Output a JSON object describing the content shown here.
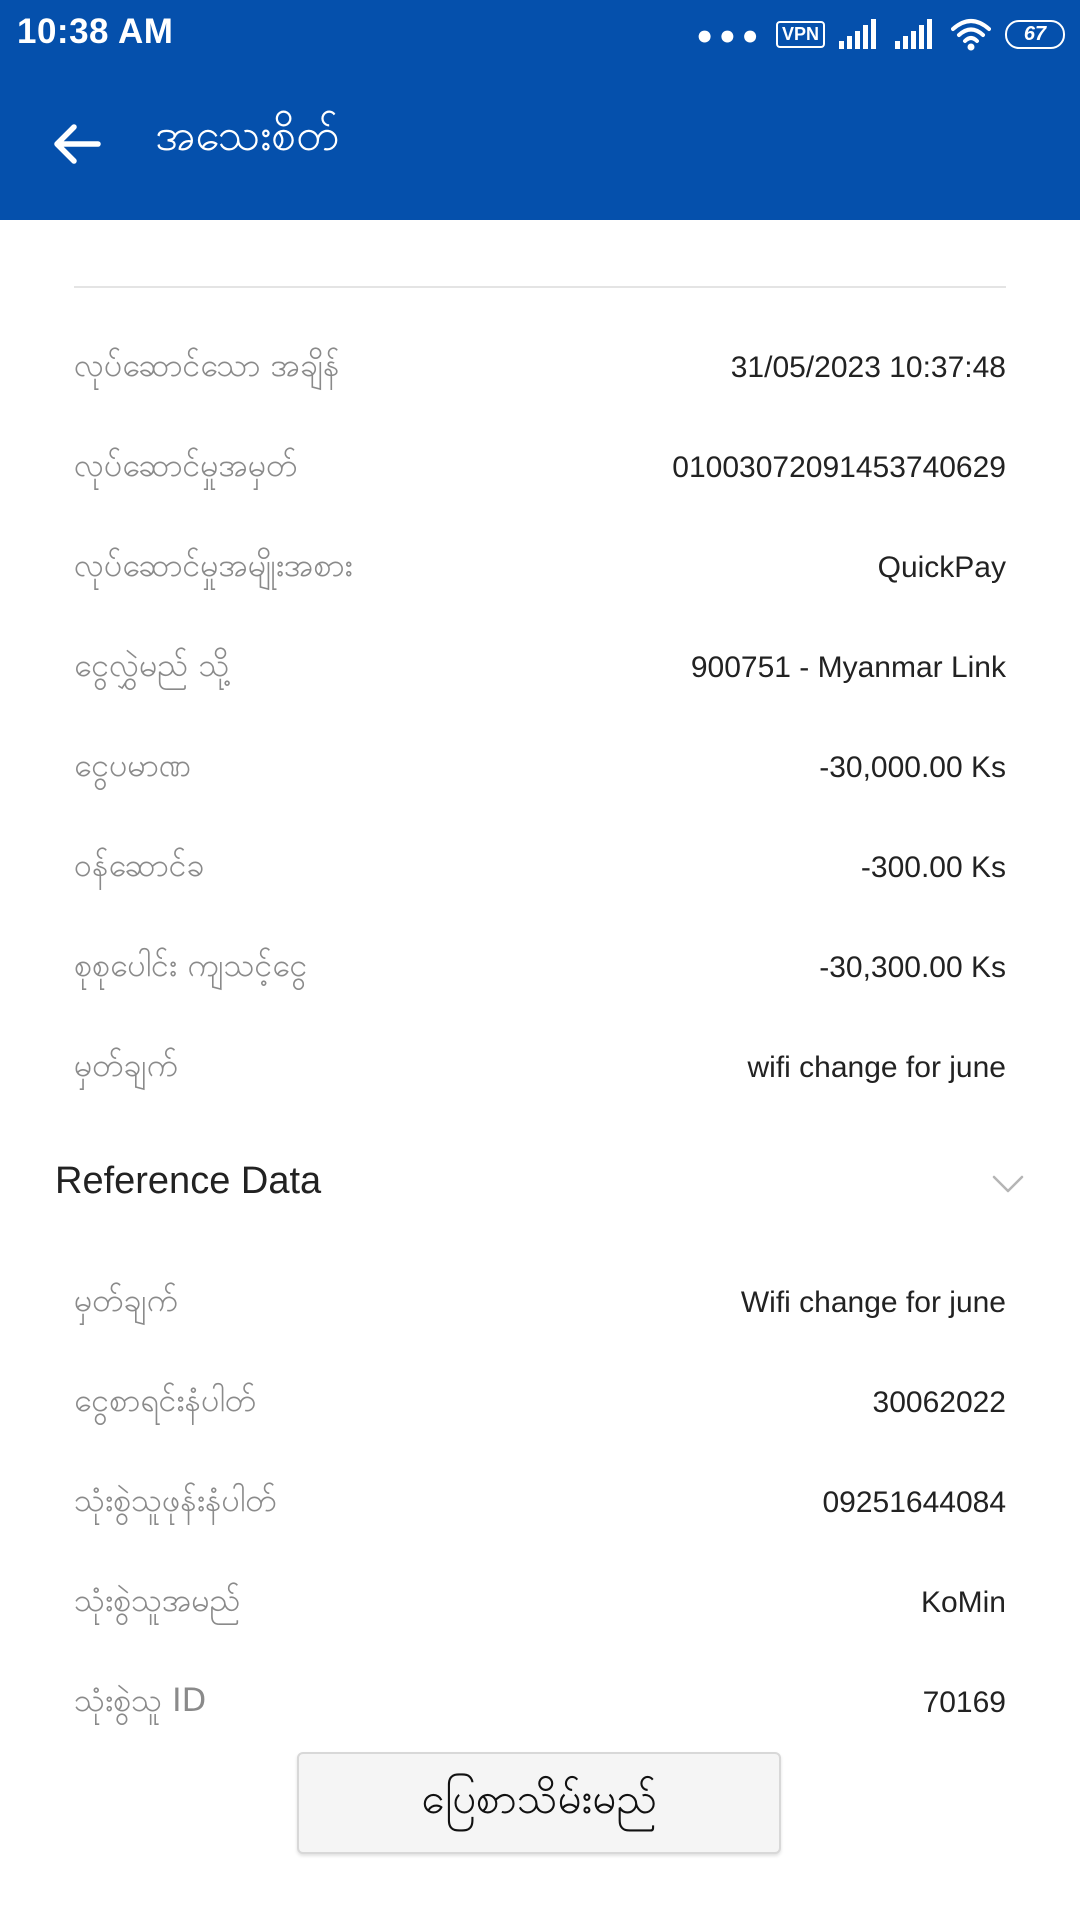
{
  "status_bar": {
    "time": "10:38 AM",
    "dots": "•••",
    "vpn": "VPN",
    "battery": "67",
    "icons": [
      "signal-icon",
      "signal-icon",
      "wifi-icon",
      "battery-icon"
    ]
  },
  "header": {
    "title": "အသေးစိတ်",
    "back_icon": "arrow-left-icon",
    "background": "#0550ac"
  },
  "details": [
    {
      "label": "လုပ်ဆောင်သော အချိန်",
      "value": "31/05/2023 10:37:48"
    },
    {
      "label": "လုပ်ဆောင်မှုအမှတ်",
      "value": "010030720914537406​29"
    },
    {
      "label": "လုပ်ဆောင်မှုအမျိုးအစား",
      "value": "QuickPay"
    },
    {
      "label": "ငွေလွှဲမည် သို့",
      "value": "900751 - Myanmar Link"
    },
    {
      "label": "ငွေပမာဏ",
      "value": "-30,000.00 Ks"
    },
    {
      "label": "ဝန်ဆောင်ခ",
      "value": "-300.00 Ks"
    },
    {
      "label": "စုစုပေါင်း ကျသင့်ငွေ",
      "value": "-30,300.00 Ks"
    },
    {
      "label": "မှတ်ချက်",
      "value": "wifi change for june"
    }
  ],
  "reference": {
    "title": "Reference Data",
    "chevron_icon": "chevron-down-icon",
    "rows": [
      {
        "label": "မှတ်ချက်",
        "value": "Wifi change for june"
      },
      {
        "label": "ငွေစာရင်းနံပါတ်",
        "value": "30062022"
      },
      {
        "label": "သုံးစွဲသူဖုန်းနံပါတ်",
        "value": "09251644084"
      },
      {
        "label": "သုံးစွဲသူအမည်",
        "value": "KoMin"
      },
      {
        "label": "သုံးစွဲသူ ID",
        "value": "70169"
      }
    ]
  },
  "actions": {
    "save_receipt": "ပြေစာသိမ်းမည်"
  }
}
